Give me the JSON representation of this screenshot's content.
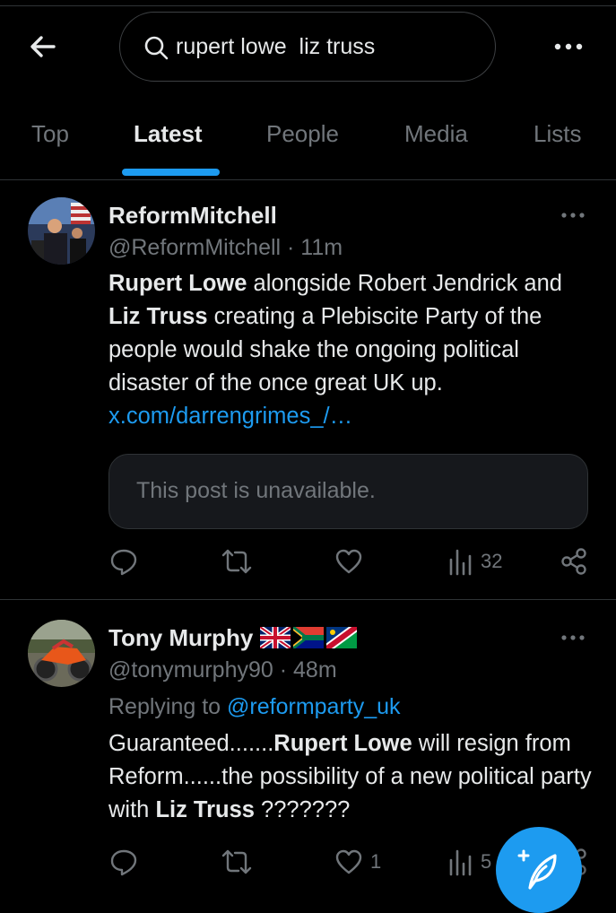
{
  "header": {
    "search_value": "rupert lowe  liz truss"
  },
  "tabs": [
    {
      "label": "Top"
    },
    {
      "label": "Latest"
    },
    {
      "label": "People"
    },
    {
      "label": "Media"
    },
    {
      "label": "Lists"
    }
  ],
  "active_tab": "Latest",
  "posts": [
    {
      "name": "ReformMitchell",
      "handle": "@ReformMitchell",
      "time": "11m",
      "body_segments": [
        {
          "text": "Rupert Lowe",
          "bold": true
        },
        {
          "text": " alongside Robert Jendrick and ",
          "bold": false
        },
        {
          "text": "Liz Truss",
          "bold": true
        },
        {
          "text": " creating a Plebiscite Party of the people would shake the ongoing political disaster of the once great UK up. ",
          "bold": false
        }
      ],
      "link": "x.com/darrengrimes_/…",
      "quote_text": "This post is unavailable.",
      "views": "32"
    },
    {
      "name": "Tony Murphy",
      "flags": [
        "uk-flag-icon",
        "south-africa-flag-icon",
        "namibia-flag-icon"
      ],
      "handle": "@tonymurphy90",
      "time": "48m",
      "replying_prefix": "Replying to ",
      "replying_handle": "@reformparty_uk",
      "body_segments": [
        {
          "text": "Guaranteed.......",
          "bold": false
        },
        {
          "text": "Rupert Lowe",
          "bold": true
        },
        {
          "text": " will resign from Reform......the possibility of a new political party with ",
          "bold": false
        },
        {
          "text": "Liz Truss",
          "bold": true
        },
        {
          "text": " ???????",
          "bold": false
        }
      ],
      "likes": "1",
      "views": "5"
    }
  ],
  "time_separator": " · ",
  "colors": {
    "background": "#000000",
    "text": "#e7e9ea",
    "secondary": "#71767b",
    "accent": "#1d9bf0",
    "divider": "#2f3336"
  }
}
